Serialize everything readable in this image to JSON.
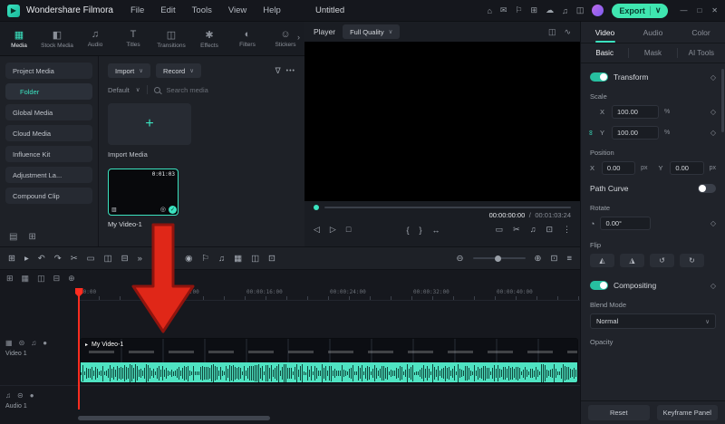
{
  "colors": {
    "accent": "#3be3c0",
    "export_button": "#3fe6b0",
    "annotation_arrow": "#e02718"
  },
  "icons": {
    "logo": "▶",
    "chev_down": "∨",
    "chev_right": "›",
    "dots": "•••",
    "plus": "+",
    "check": "✓",
    "eye": "◎",
    "clip_corner": "▥",
    "diamond": "◇",
    "filter": "∇",
    "link": "∞",
    "dial": "◔",
    "minimize": "—",
    "maximize": "□",
    "close": "✕",
    "play": "▸"
  },
  "titlebar": {
    "app_name": "Wondershare Filmora",
    "menus": [
      "File",
      "Edit",
      "Tools",
      "View",
      "Help"
    ],
    "project_title": "Untitled",
    "tray_icons": [
      "⌂",
      "✉",
      "⚐",
      "⊞",
      "☁",
      "♫",
      "◫"
    ],
    "export_label": "Export"
  },
  "media_tabs": [
    {
      "icon": "▦",
      "label": "Media"
    },
    {
      "icon": "◧",
      "label": "Stock Media"
    },
    {
      "icon": "♫",
      "label": "Audio"
    },
    {
      "icon": "T",
      "label": "Titles"
    },
    {
      "icon": "◫",
      "label": "Transitions"
    },
    {
      "icon": "✱",
      "label": "Effects"
    },
    {
      "icon": "◐",
      "label": "Filters"
    },
    {
      "icon": "☺",
      "label": "Stickers"
    }
  ],
  "sidebar": {
    "items": [
      {
        "label": "Project Media"
      },
      {
        "label": "Folder"
      },
      {
        "label": "Global Media"
      },
      {
        "label": "Cloud Media"
      },
      {
        "label": "Influence Kit"
      },
      {
        "label": "Adjustment La..."
      },
      {
        "label": "Compound Clip"
      }
    ],
    "footer_icons": [
      "▤",
      "⊞"
    ]
  },
  "media_panel": {
    "import_label": "Import",
    "record_label": "Record",
    "default_label": "Default",
    "search_placeholder": "Search media",
    "import_tile_label": "Import Media",
    "clip_name": "My Video-1",
    "clip_duration": "0:01:03"
  },
  "player": {
    "label": "Player",
    "quality": "Full Quality",
    "header_icons": [
      "◫",
      "∿"
    ],
    "current_time": "00:00:00:00",
    "separator": "/",
    "total_time": "00:01:03:24",
    "transport_left": [
      "◁",
      "▷",
      "□"
    ],
    "transport_mid": [
      "{",
      "}",
      "↔"
    ],
    "transport_right": [
      "▭",
      "✂",
      "♫",
      "⊡",
      "⋮"
    ]
  },
  "toolbar": {
    "left_icons": [
      "⊞",
      "▸",
      "↶",
      "↷",
      "✂",
      "▭",
      "◫",
      "⊟",
      "»"
    ],
    "ai_icon": "☺",
    "mid_icons": [
      "◉",
      "⚐",
      "♫",
      "▦",
      "◫",
      "⊡"
    ],
    "zoom_out": "⊖",
    "zoom_in": "⊕",
    "right_icons": [
      "⊡",
      "≡"
    ]
  },
  "timeline": {
    "toolbar_icons": [
      "⊞",
      "▦",
      "◫",
      "⊟",
      "⊕"
    ],
    "ruler": [
      "00:00",
      "00:00:08:00",
      "00:00:16:00",
      "00:00:24:00",
      "00:00:32:00",
      "00:00:40:00"
    ],
    "video_track": {
      "icons": [
        "▦",
        "⊝",
        "♫",
        "●"
      ],
      "name": "Video 1"
    },
    "audio_track": {
      "icons": [
        "♫",
        "⊝",
        "●"
      ],
      "name": "Audio 1"
    },
    "clip_name": "My Video-1"
  },
  "properties": {
    "tabs": [
      "Video",
      "Audio",
      "Color"
    ],
    "subtabs": [
      "Basic",
      "Mask",
      "AI Tools"
    ],
    "transform_label": "Transform",
    "scale_label": "Scale",
    "x_label": "X",
    "y_label": "Y",
    "scale_x": "100.00",
    "scale_y": "100.00",
    "percent_unit": "%",
    "position_label": "Position",
    "pos_x": "0.00",
    "pos_y": "0.00",
    "px_unit": "px",
    "path_curve_label": "Path Curve",
    "rotate_label": "Rotate",
    "rotate_value": "0.00°",
    "flip_label": "Flip",
    "flip_icons": [
      "◭",
      "◮",
      "↺",
      "↻"
    ],
    "compositing_label": "Compositing",
    "blend_mode_label": "Blend Mode",
    "blend_mode_value": "Normal",
    "opacity_label": "Opacity",
    "reset_label": "Reset",
    "keyframe_label": "Keyframe Panel"
  }
}
